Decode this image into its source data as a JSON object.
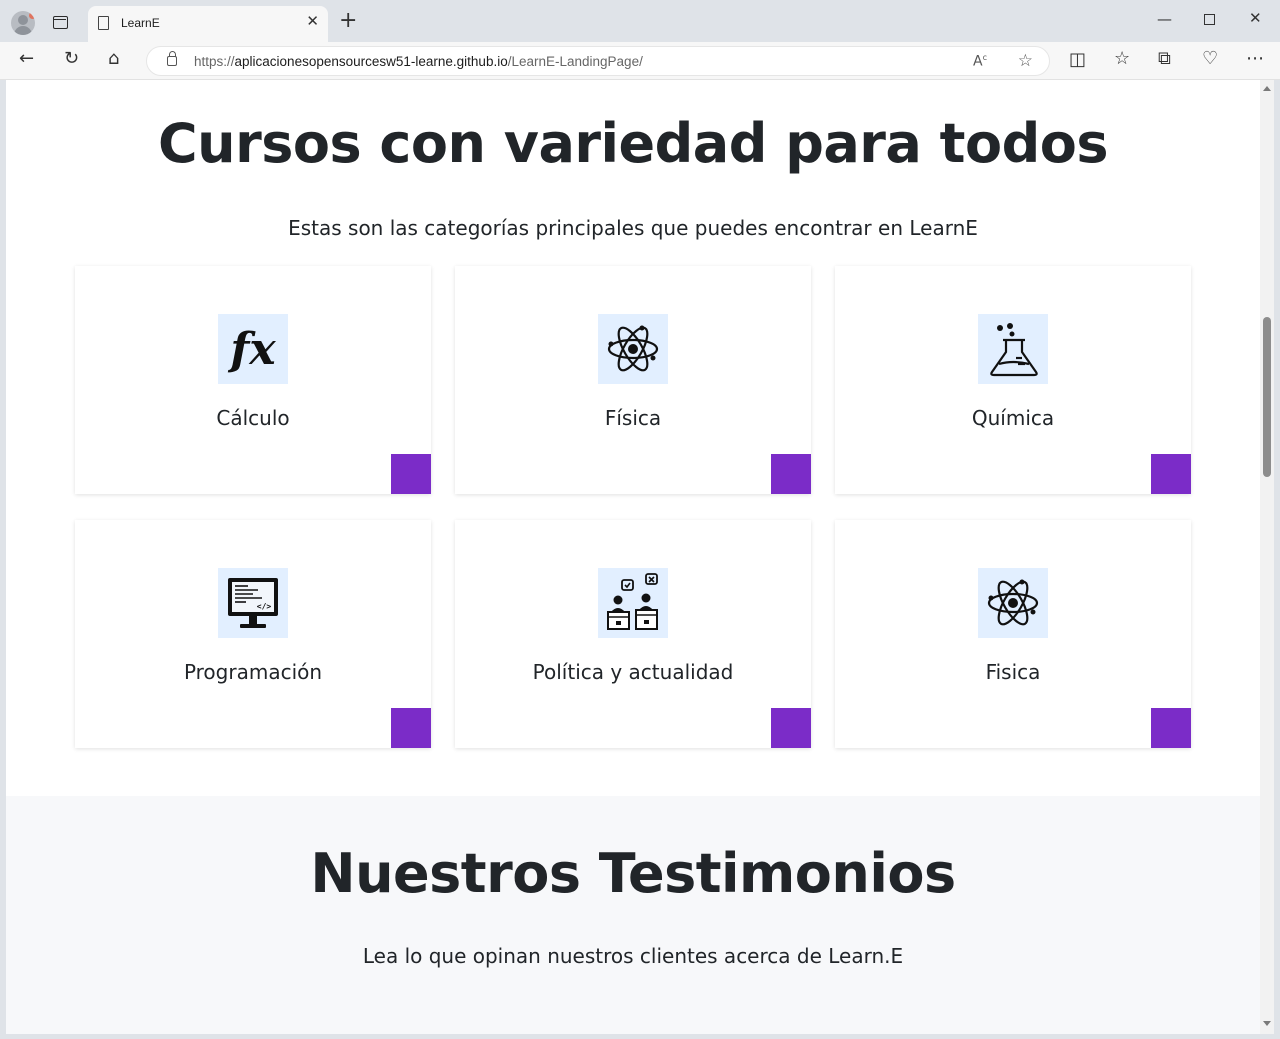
{
  "browser": {
    "tab_title": "LearnE",
    "url_prefix": "https://",
    "url_host": "aplicacionesopensourcesw51-learne.github.io",
    "url_path": "/LearnE-LandingPage/"
  },
  "courses": {
    "title": "Cursos con variedad para todos",
    "subtitle": "Estas son las categorías principales que puedes encontrar en LearnE",
    "cards": [
      {
        "label": "Cálculo",
        "icon": "function-fx-icon"
      },
      {
        "label": "Física",
        "icon": "atom-icon"
      },
      {
        "label": "Química",
        "icon": "flask-icon"
      },
      {
        "label": "Programación",
        "icon": "computer-code-icon"
      },
      {
        "label": "Política y actualidad",
        "icon": "debate-podium-icon"
      },
      {
        "label": "Fisica",
        "icon": "atom-icon"
      }
    ]
  },
  "testimonials": {
    "title": "Nuestros Testimonios",
    "subtitle": "Lea lo que opinan nuestros clientes acerca de Learn.E"
  },
  "colors": {
    "accent": "#7b2cc8",
    "icon_bg": "#e2efff",
    "text": "#212529",
    "section_bg": "#f7f8fa"
  }
}
